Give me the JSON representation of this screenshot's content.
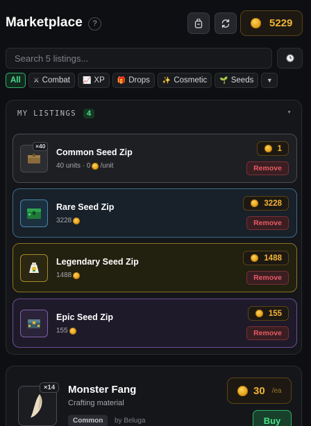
{
  "header": {
    "title": "Marketplace",
    "help_icon": "?",
    "balance": "5229"
  },
  "search": {
    "placeholder": "Search 5 listings..."
  },
  "filters": [
    {
      "label": "All",
      "icon": "",
      "active": true
    },
    {
      "label": "Combat",
      "icon": "⚔"
    },
    {
      "label": "XP",
      "icon": "📈"
    },
    {
      "label": "Drops",
      "icon": "🎁"
    },
    {
      "label": "Cosmetic",
      "icon": "✨"
    },
    {
      "label": "Seeds",
      "icon": "🌱"
    }
  ],
  "my_listings": {
    "title": "MY LISTINGS",
    "count": "4",
    "items": [
      {
        "name": "Common Seed Zip",
        "qty": "×40",
        "sub": "40 units · 0",
        "sub_suffix": "/unit",
        "price": "1",
        "remove_label": "Remove",
        "rarity": "common"
      },
      {
        "name": "Rare Seed Zip",
        "qty": "",
        "sub": "3228",
        "sub_suffix": "",
        "price": "3228",
        "remove_label": "Remove",
        "rarity": "rare"
      },
      {
        "name": "Legendary Seed Zip",
        "qty": "",
        "sub": "1488",
        "sub_suffix": "",
        "price": "1488",
        "remove_label": "Remove",
        "rarity": "legendary"
      },
      {
        "name": "Epic Seed Zip",
        "qty": "",
        "sub": "155",
        "sub_suffix": "",
        "price": "155",
        "remove_label": "Remove",
        "rarity": "epic"
      }
    ]
  },
  "market_listing": {
    "name": "Monster Fang",
    "qty": "×14",
    "subtitle": "Crafting material",
    "rarity": "Common",
    "seller": "by Beluga",
    "price": "30",
    "unit": "/ea",
    "buy_label": "Buy"
  },
  "colors": {
    "accent_green": "#4ee08a",
    "gold": "#f2b335",
    "remove_red": "#ea5a66",
    "rare_border": "#3d6c8e",
    "legendary_border": "#8b7421",
    "epic_border": "#6b4f95"
  }
}
